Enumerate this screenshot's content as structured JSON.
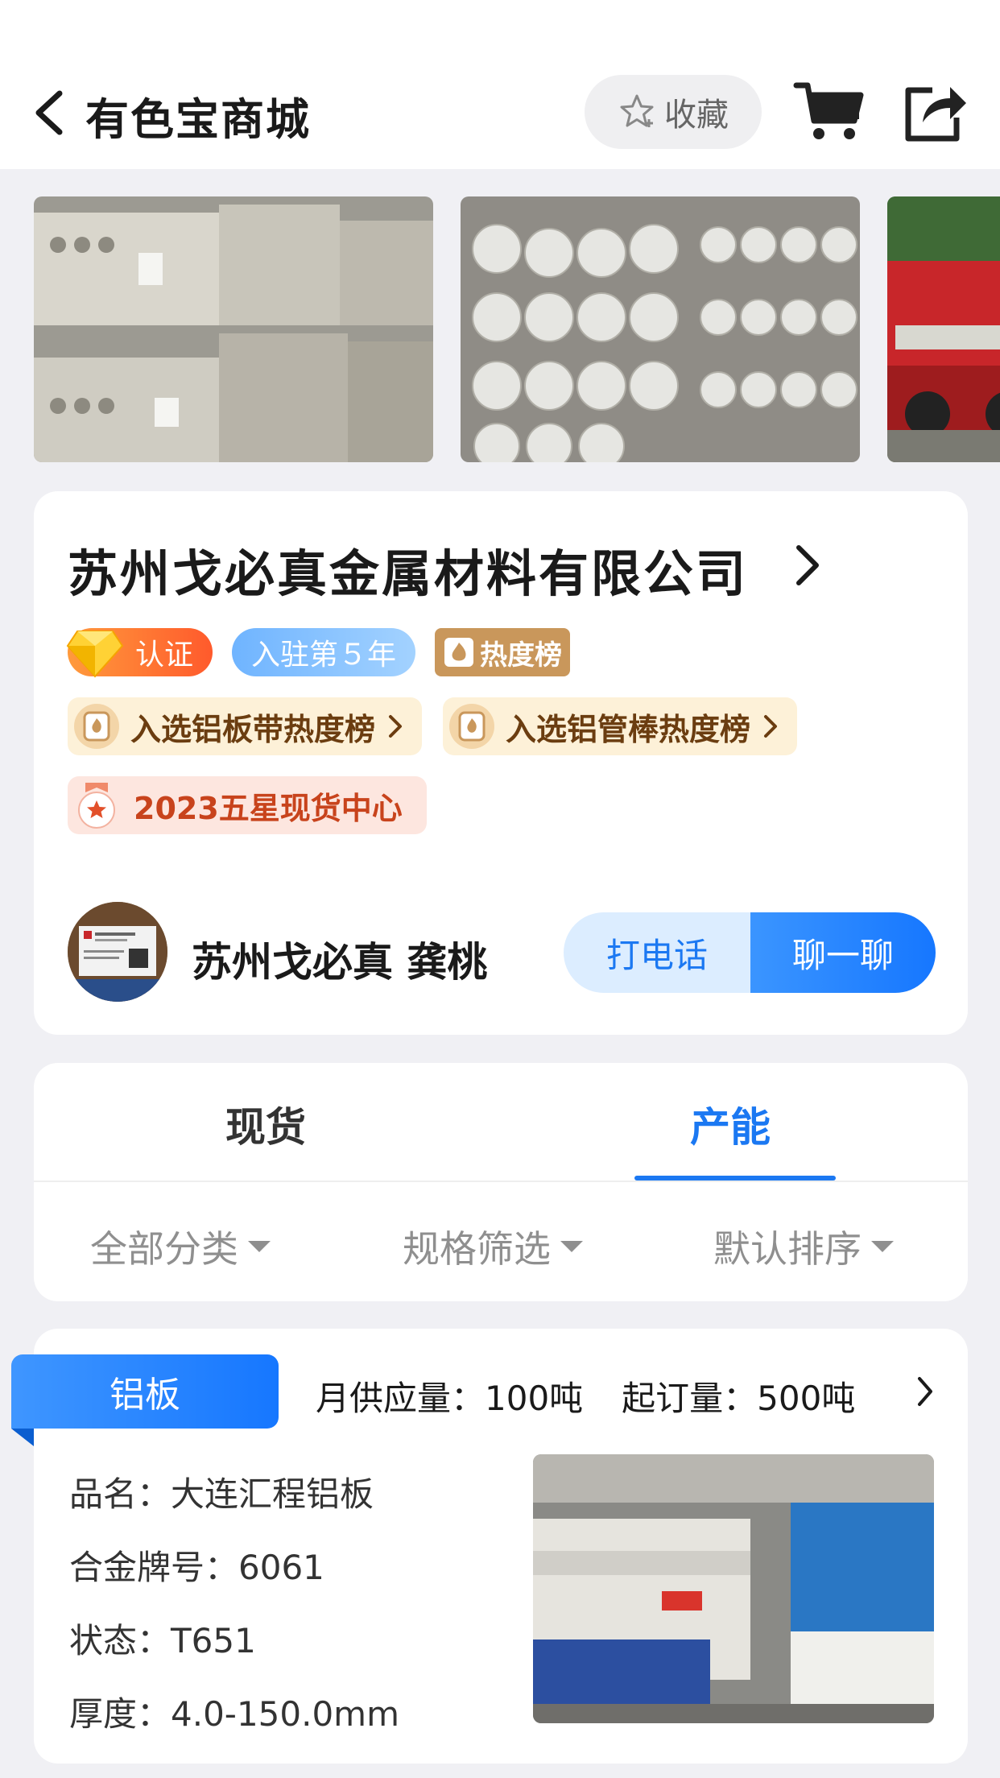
{
  "header": {
    "title": "有色宝商城",
    "favorite_label": "收藏"
  },
  "company": {
    "name": "苏州戈必真金属材料有限公司",
    "badges": {
      "certified": "认证",
      "years": "入驻第５年",
      "hot": "热度榜"
    },
    "rankings": [
      "入选铝板带热度榜",
      "入选铝管棒热度榜"
    ],
    "star_award": "2023五星现货中心",
    "contact": {
      "name": "苏州戈必真 龚桃",
      "call_label": "打电话",
      "chat_label": "聊一聊"
    }
  },
  "tabs": [
    {
      "label": "现货",
      "active": false
    },
    {
      "label": "产能",
      "active": true
    }
  ],
  "filters": [
    "全部分类",
    "规格筛选",
    "默认排序"
  ],
  "product": {
    "category": "铝板",
    "monthly_supply": "月供应量：100吨",
    "min_order": "起订量：500吨",
    "specs": [
      "品名：大连汇程铝板",
      "合金牌号：6061",
      "状态：T651",
      "厚度：4.0-150.0mm"
    ]
  },
  "colors": {
    "accent_blue": "#1b78f2",
    "gold_badge": "#c9975b",
    "rank_text": "#6b3d10",
    "star_text": "#c8431c"
  }
}
